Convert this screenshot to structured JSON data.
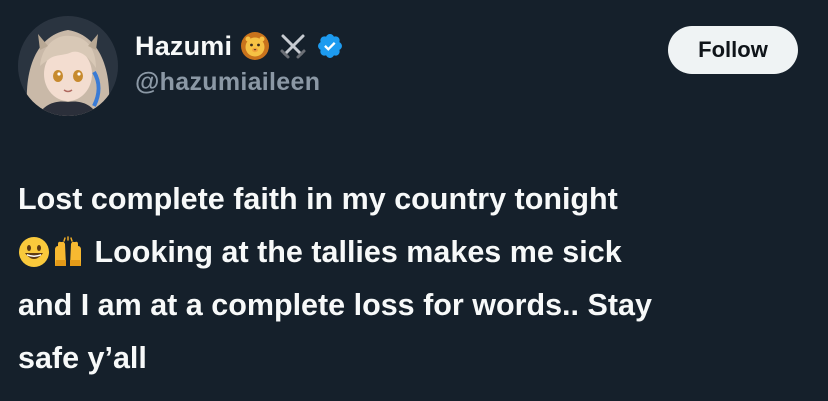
{
  "user": {
    "display_name": "Hazumi",
    "handle": "@hazumiaileen",
    "badges": [
      "lion-face-icon",
      "crossed-swords-icon",
      "verified-badge-icon"
    ],
    "accent_color": "#1d9bf0"
  },
  "follow_button": {
    "label": "Follow"
  },
  "post": {
    "line1": "Lost complete faith in my country tonight",
    "emojis": [
      "grinning-face-icon",
      "raising-hands-icon"
    ],
    "line2_rest": " Looking at the tallies makes me sick",
    "line3": "and I am at a complete loss for words.. Stay",
    "line4": "safe y’all"
  },
  "theme": {
    "background": "#15202b",
    "text": "#f7f9f9",
    "secondary_text": "#8b98a5",
    "button_bg": "#eff3f4"
  }
}
